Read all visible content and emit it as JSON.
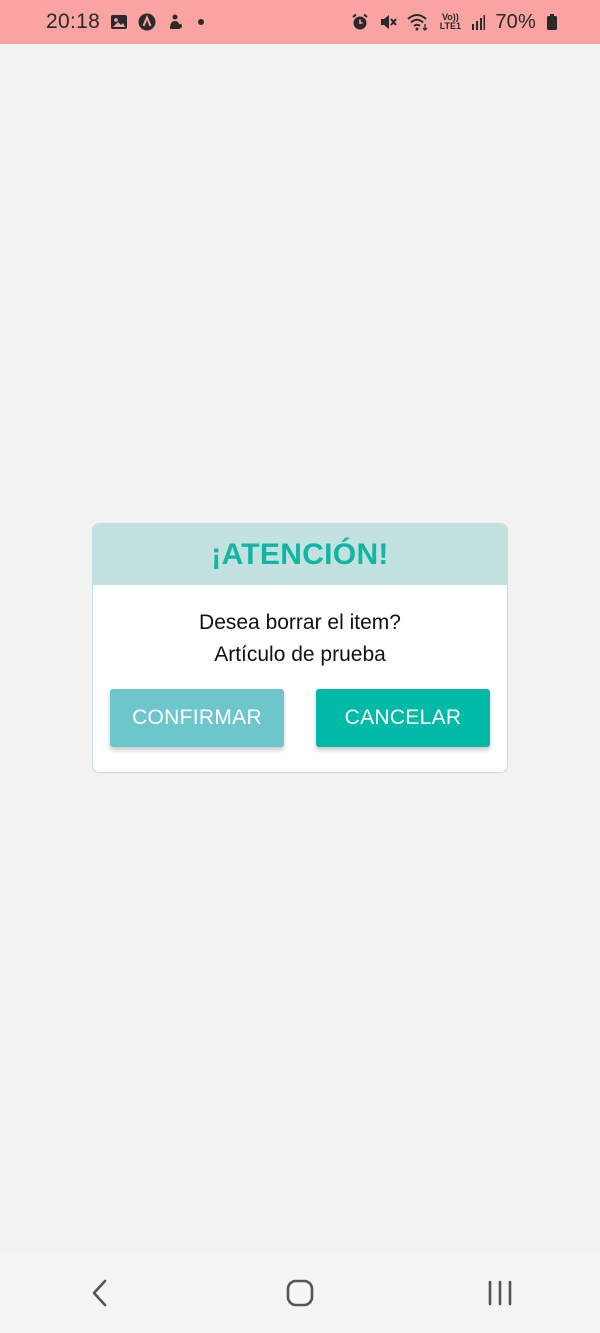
{
  "status_bar": {
    "time": "20:18",
    "battery": "70%",
    "network_label": "Vo)) LTE1",
    "icons": [
      "gallery-icon",
      "app-a-icon",
      "notification-icon",
      "dot-icon",
      "alarm-icon",
      "mute-icon",
      "wifi-icon",
      "lte-icon",
      "signal-icon",
      "battery-icon"
    ]
  },
  "dialog": {
    "title": "¡ATENCIÓN!",
    "message_line1": "Desea borrar el item?",
    "message_line2": "Artículo de prueba",
    "confirm_label": "CONFIRMAR",
    "cancel_label": "CANCELAR"
  },
  "nav_bar": {
    "icons": [
      "back-icon",
      "home-icon",
      "recents-icon"
    ]
  },
  "colors": {
    "status_bar": "#f9a3a3",
    "background": "#f2f2f2",
    "header_bg": "#c2e1df",
    "title": "#10b5a3",
    "confirm_button": "#6cc6cc",
    "cancel_button": "#00b9a6"
  }
}
